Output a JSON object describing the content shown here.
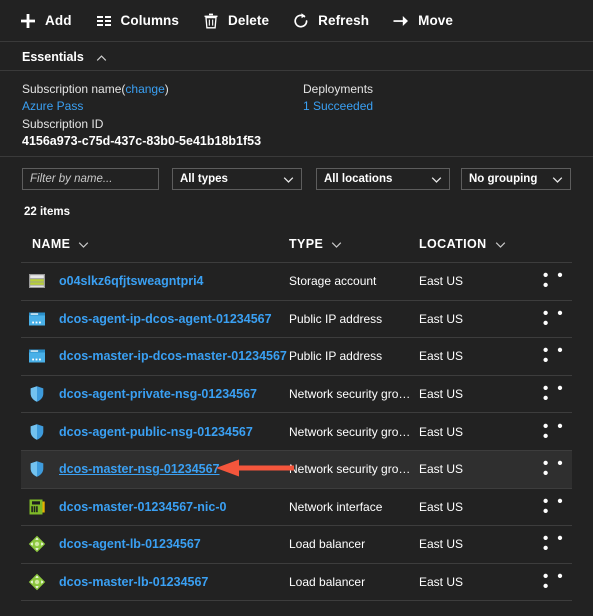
{
  "toolbar": {
    "items": [
      {
        "label": "Add",
        "icon": "plus-icon"
      },
      {
        "label": "Columns",
        "icon": "columns-icon"
      },
      {
        "label": "Delete",
        "icon": "trash-icon"
      },
      {
        "label": "Refresh",
        "icon": "refresh-icon"
      },
      {
        "label": "Move",
        "icon": "arrow-right-icon"
      }
    ]
  },
  "essentials": {
    "title": "Essentials",
    "collapse_icon": "chevron-up-icon",
    "subscription_name_label": "Subscription name",
    "change_link": "change",
    "paren_open": "(",
    "paren_close": ")",
    "subscription_name_value": "Azure Pass",
    "subscription_id_label": "Subscription ID",
    "subscription_id_value": "4156a973-c75d-437c-83b0-5e41b18b1f53",
    "deployments_label": "Deployments",
    "deployments_value": "1 Succeeded"
  },
  "filters": {
    "name_placeholder": "Filter by name...",
    "name_value": "",
    "type_selected": "All types",
    "location_selected": "All locations",
    "grouping_selected": "No grouping",
    "caret_icon": "chevron-down-icon"
  },
  "table": {
    "items_count": "22 items",
    "columns": [
      {
        "label": "NAME",
        "sort_icon": "chevron-down-icon"
      },
      {
        "label": "TYPE",
        "sort_icon": "chevron-down-icon"
      },
      {
        "label": "LOCATION",
        "sort_icon": "chevron-down-icon"
      }
    ],
    "focused_column": "TYPE",
    "more_menu_icon": "ellipsis-icon",
    "rows": [
      {
        "icon": "storage-account-icon",
        "name": "o04slkz6qfjtsweagntpri4",
        "type": "Storage account",
        "location": "East US",
        "selected": false
      },
      {
        "icon": "public-ip-icon",
        "name": "dcos-agent-ip-dcos-agent-01234567",
        "type": "Public IP address",
        "location": "East US",
        "selected": false
      },
      {
        "icon": "public-ip-icon",
        "name": "dcos-master-ip-dcos-master-01234567",
        "type": "Public IP address",
        "location": "East US",
        "selected": false
      },
      {
        "icon": "nsg-shield-icon",
        "name": "dcos-agent-private-nsg-01234567",
        "type": "Network security gro…",
        "location": "East US",
        "selected": false
      },
      {
        "icon": "nsg-shield-icon",
        "name": "dcos-agent-public-nsg-01234567",
        "type": "Network security gro…",
        "location": "East US",
        "selected": false
      },
      {
        "icon": "nsg-shield-icon",
        "name": "dcos-master-nsg-01234567",
        "type": "Network security gro…",
        "location": "East US",
        "selected": true
      },
      {
        "icon": "network-interface-icon",
        "name": "dcos-master-01234567-nic-0",
        "type": "Network interface",
        "location": "East US",
        "selected": false
      },
      {
        "icon": "load-balancer-icon",
        "name": "dcos-agent-lb-01234567",
        "type": "Load balancer",
        "location": "East US",
        "selected": false
      },
      {
        "icon": "load-balancer-icon",
        "name": "dcos-master-lb-01234567",
        "type": "Load balancer",
        "location": "East US",
        "selected": false
      }
    ]
  },
  "annotation": {
    "arrow_icon": "red-arrow-left-icon",
    "arrow_color": "#f4563c",
    "points_at_row": "dcos-master-nsg-01234567"
  },
  "colors": {
    "background": "#222222",
    "link": "#3aa0f3",
    "focus_outline": "#3aa0f3",
    "row_selected": "#2f2f2f",
    "divider": "#3d3d3d"
  }
}
